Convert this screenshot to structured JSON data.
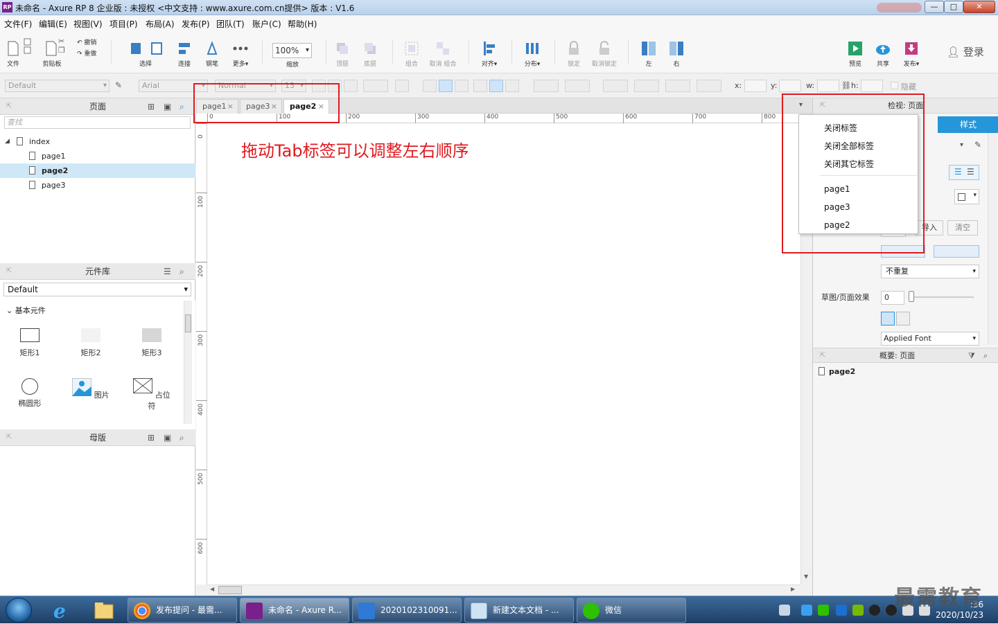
{
  "window": {
    "app_icon_label": "RP",
    "title": "未命名 - Axure RP 8 企业版 : 未授权        <中文支持 : www.axure.com.cn提供> 版本 : V1.6",
    "btn_min": "—",
    "btn_max": "□",
    "btn_close": "✕"
  },
  "menu": [
    "文件(F)",
    "编辑(E)",
    "视图(V)",
    "项目(P)",
    "布局(A)",
    "发布(P)",
    "团队(T)",
    "账户(C)",
    "帮助(H)"
  ],
  "toolbar": {
    "file": "文件",
    "paste": "剪贴板",
    "undo": "撤销",
    "redo": "重做",
    "select": "选择",
    "connect": "连接",
    "pen": "钢笔",
    "more": "更多▾",
    "zoom_value": "100%",
    "zoom_label": "缩放",
    "top": "顶层",
    "bottom": "底层",
    "group": "组合",
    "ungroup": "取消 组合",
    "align": "对齐▾",
    "distribute": "分布▾",
    "lock": "锁定",
    "unlock": "取消锁定",
    "left": "左",
    "right": "右",
    "preview": "预览",
    "share": "共享",
    "publish": "发布▾",
    "login": "登录"
  },
  "format": {
    "style_select": "Default",
    "font_select": "Arial",
    "weight_select": "Normal",
    "size_select": "13",
    "x_label": "x:",
    "y_label": "y:",
    "w_label": "w:",
    "h_label": "h:",
    "hide_label": "隐藏"
  },
  "pages_panel": {
    "title": "页面",
    "search_placeholder": "查找",
    "items": [
      {
        "label": "index"
      },
      {
        "label": "page1"
      },
      {
        "label": "page2"
      },
      {
        "label": "page3"
      }
    ]
  },
  "library_panel": {
    "title": "元件库",
    "selected_library": "Default",
    "group": "基本元件",
    "widgets": [
      "矩形1",
      "矩形2",
      "矩形3",
      "椭圆形",
      "图片",
      "占位符"
    ]
  },
  "master_panel": {
    "title": "母版"
  },
  "tabs": [
    {
      "label": "page1"
    },
    {
      "label": "page3"
    },
    {
      "label": "page2"
    }
  ],
  "ruler_h": [
    "0",
    "100",
    "200",
    "300",
    "400",
    "500",
    "600",
    "700",
    "800"
  ],
  "ruler_v": [
    "0",
    "100",
    "200",
    "300",
    "400",
    "500",
    "600"
  ],
  "annotation": "拖动Tab标签可以调整左右顺序",
  "context_menu": {
    "close_tab": "关闭标签",
    "close_all": "关闭全部标签",
    "close_others": "关闭其它标签",
    "tab_list": [
      "page1",
      "page3",
      "page2"
    ]
  },
  "inspector": {
    "title": "检视: 页面",
    "style_tab": "样式",
    "import_btn": "导入",
    "clear_btn": "清空",
    "repeat_select": "不重复",
    "sketch_label": "草图/页面效果",
    "sketch_value": "0",
    "font_select": "Applied Font"
  },
  "overview": {
    "title": "概要: 页面",
    "item": "page2"
  },
  "taskbar": {
    "items": [
      "发布提问 - 最需...",
      "未命名 - Axure R...",
      "2020102310091...",
      "新建文本文档 - ...",
      "微信"
    ],
    "clock_time": ":36",
    "clock_date": "2020/10/23"
  },
  "watermark": "最需教育",
  "colors": {
    "accent": "#2596d9",
    "annotation": "#e0191e",
    "selection": "#cfe8f7"
  }
}
